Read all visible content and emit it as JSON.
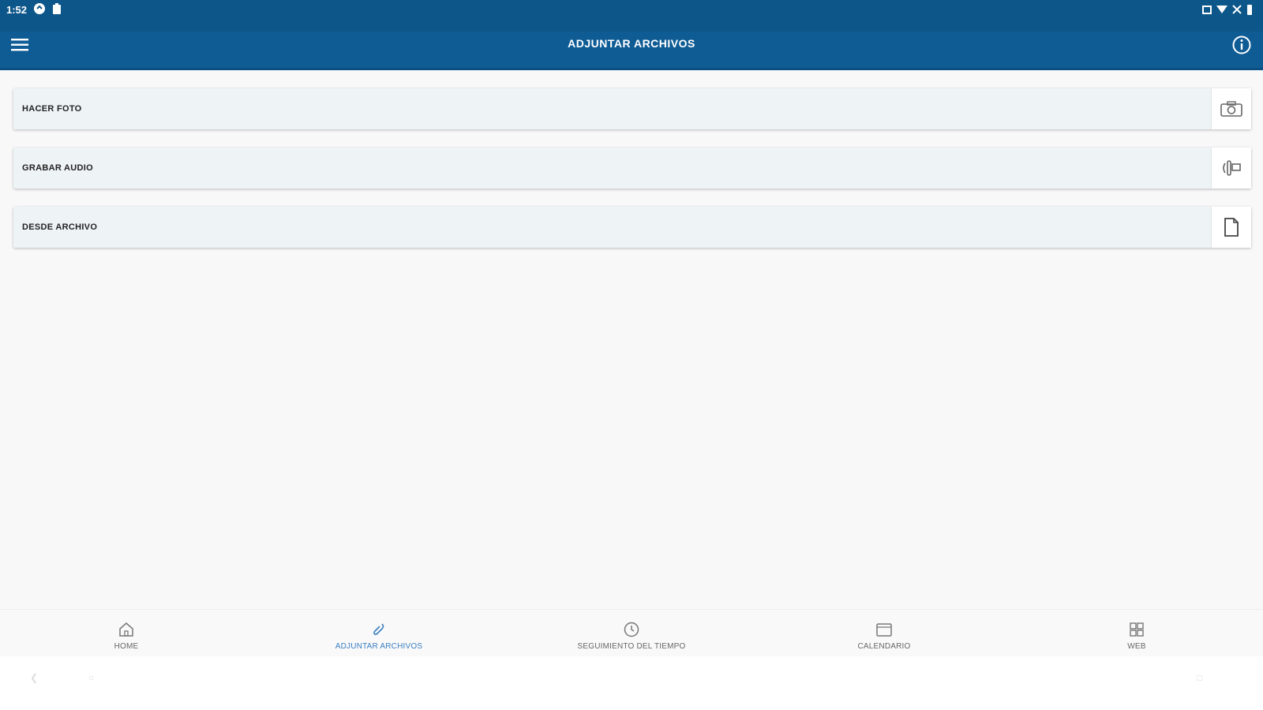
{
  "status": {
    "time": "1:52",
    "accent": "#0c568a"
  },
  "appbar": {
    "title": "ADJUNTAR ARCHIVOS",
    "menu_icon": "menu-icon",
    "info_icon": "info-icon",
    "color": "#0f5c95"
  },
  "actions": [
    {
      "label": "HACER FOTO",
      "icon": "camera-icon"
    },
    {
      "label": "GRABAR AUDIO",
      "icon": "audio-icon"
    },
    {
      "label": "DESDE ARCHIVO",
      "icon": "file-icon"
    }
  ],
  "bottom_nav": [
    {
      "label": "HOME",
      "icon": "home-icon",
      "active": false
    },
    {
      "label": "ADJUNTAR ARCHIVOS",
      "icon": "attachment-icon",
      "active": true
    },
    {
      "label": "SEGUIMIENTO DEL TIEMPO",
      "icon": "clock-icon",
      "active": false
    },
    {
      "label": "CALENDARIO",
      "icon": "calendar-icon",
      "active": false
    },
    {
      "label": "WEB",
      "icon": "grid-icon",
      "active": false
    }
  ],
  "active_color": "#3a7fc2"
}
